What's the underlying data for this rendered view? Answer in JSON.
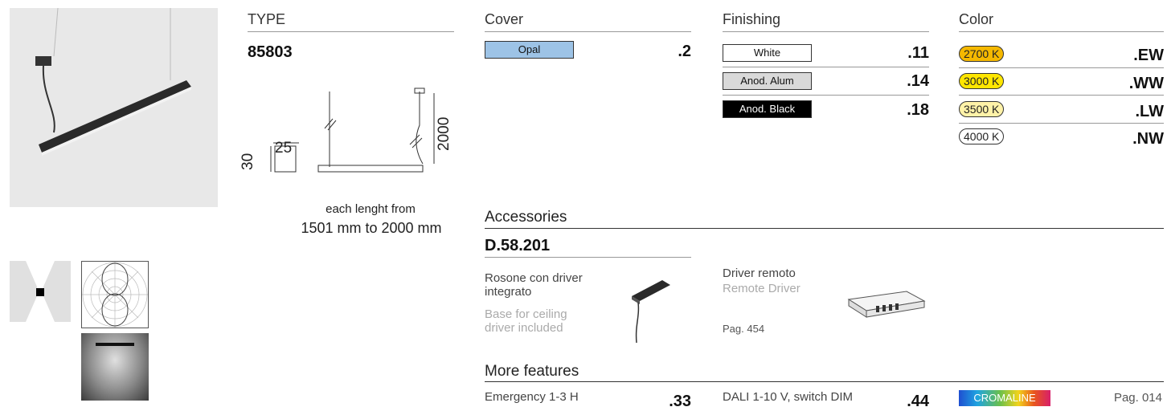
{
  "type_section": {
    "heading": "TYPE",
    "code": "85803"
  },
  "drawing": {
    "width_dim": "25",
    "height_dim": "30",
    "drop_dim": "2000",
    "caption_line1": "each lenght from",
    "caption_line2": "1501 mm to 2000 mm"
  },
  "cover": {
    "heading": "Cover",
    "items": [
      {
        "label": "Opal",
        "code": ".2",
        "bg": "#9dc3e6",
        "fg": "#111111"
      }
    ]
  },
  "finishing": {
    "heading": "Finishing",
    "items": [
      {
        "label": "White",
        "code": ".11",
        "bg": "#ffffff",
        "fg": "#111111"
      },
      {
        "label": "Anod. Alum",
        "code": ".14",
        "bg": "#d9d9d9",
        "fg": "#111111"
      },
      {
        "label": "Anod. Black",
        "code": ".18",
        "bg": "#000000",
        "fg": "#ffffff"
      }
    ]
  },
  "color": {
    "heading": "Color",
    "items": [
      {
        "label": "2700 K",
        "code": ".EW",
        "bg": "#f5b800"
      },
      {
        "label": "3000 K",
        "code": ".WW",
        "bg": "#ffe600"
      },
      {
        "label": "3500 K",
        "code": ".LW",
        "bg": "#fff2a8"
      },
      {
        "label": "4000 K",
        "code": ".NW",
        "bg": "#ffffff"
      }
    ]
  },
  "accessories": {
    "heading": "Accessories",
    "code": "D.58.201",
    "item1": {
      "it": "Rosone con driver integrato",
      "en": "Base for ceiling driver included"
    },
    "item2": {
      "it": "Driver remoto",
      "en": "Remote Driver",
      "page": "Pag. 454"
    }
  },
  "more_features": {
    "heading": "More features",
    "emergency": {
      "label": "Emergency 1-3 H",
      "code": ".33"
    },
    "dali": {
      "label": "DALI 1-10 V, switch DIM",
      "code": ".44"
    },
    "cromaline": "CROMALINE",
    "page": "Pag. 014"
  }
}
